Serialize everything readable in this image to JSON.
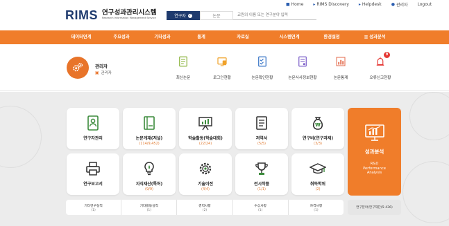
{
  "header": {
    "logo": {
      "mark": "RIMS",
      "title": "연구성과관리시스템",
      "subtitle": "Research Information Management Service"
    },
    "search": {
      "toggle_active": "연구자",
      "toggle_inactive": "논문",
      "placeholder": "교원의 이름 또는 연구분야 입력"
    },
    "top_links": [
      {
        "label": "Home",
        "icon": "home-icon"
      },
      {
        "label": "RIMS Discovery",
        "icon": "arrow-icon"
      },
      {
        "label": "Helpdesk",
        "icon": "arrow-icon"
      },
      {
        "label": "관리자",
        "icon": "user-icon"
      },
      {
        "label": "Logout",
        "icon": ""
      }
    ]
  },
  "nav": {
    "items": [
      {
        "label": "데이터연계",
        "icon": ""
      },
      {
        "label": "주요성과",
        "icon": ""
      },
      {
        "label": "기타성과",
        "icon": ""
      },
      {
        "label": "통계",
        "icon": ""
      },
      {
        "label": "자료실",
        "icon": ""
      },
      {
        "label": "시스템연계",
        "icon": ""
      },
      {
        "label": "환경설정",
        "icon": ""
      },
      {
        "label": "성과분석",
        "icon": "chart-icon"
      }
    ]
  },
  "admin": {
    "name": "관리자",
    "role": "관리자",
    "quick_links": [
      {
        "label": "최신논문",
        "icon": "document-icon"
      },
      {
        "label": "로그인현황",
        "icon": "login-icon"
      },
      {
        "label": "논문확인현황",
        "icon": "checklist-icon"
      },
      {
        "label": "논문사사정보현황",
        "icon": "report-icon"
      },
      {
        "label": "논문통계",
        "icon": "bar-chart-icon"
      },
      {
        "label": "오류신고현황",
        "icon": "alarm-icon",
        "badge": "9"
      }
    ]
  },
  "cards": [
    {
      "label": "연구자관리",
      "count": "",
      "icon": "researcher-icon"
    },
    {
      "label": "논문게재(저널)",
      "count": "(114/9,452)",
      "icon": "journal-icon"
    },
    {
      "label": "학술활동(학술대회)",
      "count": "(22/24)",
      "icon": "presentation-icon"
    },
    {
      "label": "저역서",
      "count": "(5/5)",
      "icon": "book-icon"
    },
    {
      "label": "연구비(연구과제)",
      "count": "(3/3)",
      "icon": "money-bag-icon"
    },
    {
      "label": "연구보고서",
      "count": "",
      "icon": "printer-icon"
    },
    {
      "label": "지식재산(특허)",
      "count": "(9/9)",
      "icon": "lightbulb-icon"
    },
    {
      "label": "기술이전",
      "count": "(4/4)",
      "icon": "gear-icon"
    },
    {
      "label": "전시작품",
      "count": "(1/1)",
      "icon": "trophy-icon"
    },
    {
      "label": "취득학위",
      "count": "(2)",
      "icon": "graduation-cap-icon"
    }
  ],
  "feature": {
    "title": "성과분석",
    "sub1": "R&D",
    "sub2": "Performance",
    "sub3": "Analysis",
    "icon": "analytics-icon"
  },
  "bottom_items": [
    {
      "label": "기타연구실적",
      "count": "(1)"
    },
    {
      "label": "기타활동실적",
      "count": "(1)"
    },
    {
      "label": "경력사항",
      "count": "(2)"
    },
    {
      "label": "수상사항",
      "count": "(1)"
    },
    {
      "label": "자격사항",
      "count": "(1)"
    }
  ],
  "bottom_feature": "연구분야(연구재단(5-436)",
  "colors": {
    "accent": "#f07d2a",
    "brand": "#1f3b6e",
    "badge": "#e53935"
  }
}
